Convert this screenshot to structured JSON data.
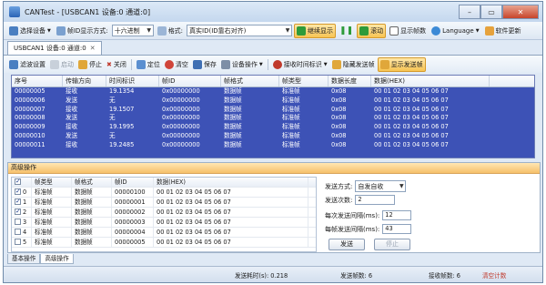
{
  "window": {
    "title": "CANTest - [USBCAN1 设备:0 通道:0]"
  },
  "toolbar": {
    "select_device": "选择设备",
    "frame_id_mode_label": "帧ID显示方式:",
    "frame_id_mode": "十六进制",
    "format_label": "格式:",
    "format": "真实ID(ID靠右对齐)",
    "continue_display": "继续显示",
    "scroll": "滚动",
    "show_frame_count": "显示帧数",
    "language": "Language",
    "software_update": "软件更新"
  },
  "tab": {
    "label": "USBCAN1 设备:0 通道:0"
  },
  "actions": {
    "filter": "滤波设置",
    "start": "启动",
    "stop": "停止",
    "close": "关闭",
    "locate": "定位",
    "clear": "清空",
    "save": "保存",
    "device_ops": "设备操作",
    "receive_timestamp": "接收时间标识",
    "hide_send_frames": "隐藏发送帧",
    "show_send_frames": "显示发送帧"
  },
  "grid": {
    "headers": [
      "序号",
      "传输方向",
      "时间标识",
      "帧ID",
      "帧格式",
      "帧类型",
      "数据长度",
      "数据(HEX)"
    ],
    "rows": [
      [
        "00000005",
        "接收",
        "19.1354",
        "0x00000000",
        "数据帧",
        "标准帧",
        "0x08",
        "00 01 02 03 04 05 06 07"
      ],
      [
        "00000006",
        "发送",
        "无",
        "0x00000000",
        "数据帧",
        "标准帧",
        "0x08",
        "00 01 02 03 04 05 06 07"
      ],
      [
        "00000007",
        "接收",
        "19.1507",
        "0x00000000",
        "数据帧",
        "标准帧",
        "0x08",
        "00 01 02 03 04 05 06 07"
      ],
      [
        "00000008",
        "发送",
        "无",
        "0x00000000",
        "数据帧",
        "标准帧",
        "0x08",
        "00 01 02 03 04 05 06 07"
      ],
      [
        "00000009",
        "接收",
        "19.1995",
        "0x00000000",
        "数据帧",
        "标准帧",
        "0x08",
        "00 01 02 03 04 05 06 07"
      ],
      [
        "00000010",
        "发送",
        "无",
        "0x00000000",
        "数据帧",
        "标准帧",
        "0x08",
        "00 01 02 03 04 05 06 07"
      ],
      [
        "00000011",
        "接收",
        "19.2485",
        "0x00000000",
        "数据帧",
        "标准帧",
        "0x08",
        "00 01 02 03 04 05 06 07"
      ]
    ]
  },
  "advanced": {
    "title": "高级操作",
    "headers": [
      "",
      "帧类型",
      "帧格式",
      "帧ID",
      "数据(HEX)"
    ],
    "rows": [
      {
        "checked": true,
        "index": "0",
        "type": "标准帧",
        "format": "数据帧",
        "id": "00000100",
        "data": "00 01 02 03 04 05 06 07"
      },
      {
        "checked": true,
        "index": "1",
        "type": "标准帧",
        "format": "数据帧",
        "id": "00000001",
        "data": "00 01 02 03 04 05 06 07"
      },
      {
        "checked": true,
        "index": "2",
        "type": "标准帧",
        "format": "数据帧",
        "id": "00000002",
        "data": "00 01 02 03 04 05 06 07"
      },
      {
        "checked": false,
        "index": "3",
        "type": "标准帧",
        "format": "数据帧",
        "id": "00000003",
        "data": "00 01 02 03 04 05 06 07"
      },
      {
        "checked": false,
        "index": "4",
        "type": "标准帧",
        "format": "数据帧",
        "id": "00000004",
        "data": "00 01 02 03 04 05 06 07"
      },
      {
        "checked": false,
        "index": "5",
        "type": "标准帧",
        "format": "数据帧",
        "id": "00000005",
        "data": "00 01 02 03 04 05 06 07"
      }
    ],
    "send_mode_label": "发送方式:",
    "send_mode": "自发自收",
    "send_count_label": "发送次数:",
    "send_count": "2",
    "interval_each_label": "每次发送间隔(ms):",
    "interval_each": "12",
    "interval_frame_label": "每帧发送间隔(ms):",
    "interval_frame": "43",
    "send_button": "发送",
    "stop_button": "停止"
  },
  "bottom_tabs": [
    "基本操作",
    "高级操作"
  ],
  "status": {
    "send_time": "发送耗时(s): 0.218",
    "send_frames": "发送帧数: 6",
    "recv_frames": "接收帧数: 6",
    "clear_count": "清空计数"
  },
  "colors": {
    "selection": "#3d52b6",
    "highlight": "#f7c453",
    "accent_red": "#c0392b"
  }
}
